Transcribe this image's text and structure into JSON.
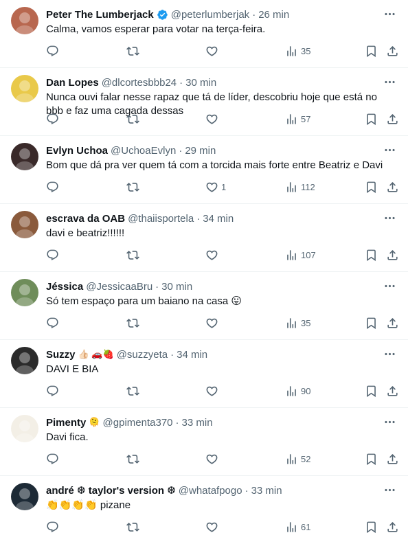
{
  "tweets": [
    {
      "name": "Peter The Lumberjack",
      "handle": "@peterlumberjak",
      "time": "26 min",
      "text": "Calma, vamos esperar para votar na terça-feira.",
      "verified": true,
      "name_emoji": "",
      "likes": "",
      "views": "35",
      "avatar_color": "#b8674f"
    },
    {
      "name": "Dan Lopes",
      "handle": "@dlcortesbbb24",
      "time": "30 min",
      "text": "Nunca ouvi falar nesse rapaz que tá de líder, descobriu hoje que está no bbb e faz uma cagada dessas",
      "verified": false,
      "name_emoji": "",
      "likes": "",
      "views": "57",
      "avatar_color": "#e9c94a"
    },
    {
      "name": "Evlyn Uchoa",
      "handle": "@UchoaEvlyn",
      "time": "29 min",
      "text": "Bom que dá pra ver quem tá com a torcida mais forte entre Beatriz e Davi",
      "verified": false,
      "name_emoji": "",
      "likes": "1",
      "views": "112",
      "avatar_color": "#3a2a2a"
    },
    {
      "name": "escrava da OAB",
      "handle": "@thaiisportela",
      "time": "34 min",
      "text": "davi e beatriz!!!!!!",
      "verified": false,
      "name_emoji": "",
      "likes": "",
      "views": "107",
      "avatar_color": "#8a5a3c"
    },
    {
      "name": "Jéssica",
      "handle": "@JessicaaBru",
      "time": "30 min",
      "text": "Só tem espaço para um baiano na casa 😛",
      "verified": false,
      "name_emoji": "",
      "likes": "",
      "views": "35",
      "avatar_color": "#6f8d5a"
    },
    {
      "name": "Suzzy",
      "handle": "@suzzyeta",
      "time": "34 min",
      "text": "DAVI E BIA",
      "verified": false,
      "name_emoji": "👍🏻 🚗🍓",
      "likes": "",
      "views": "90",
      "avatar_color": "#2b2b2b"
    },
    {
      "name": "Pimenty",
      "handle": "@gpimenta370",
      "time": "33 min",
      "text": "Davi fica.",
      "verified": false,
      "name_emoji": "🫠",
      "likes": "",
      "views": "52",
      "avatar_color": "#f3efe6"
    },
    {
      "name": "andré ❆ taylor's version ❆",
      "handle": "@whatafpogo",
      "time": "33 min",
      "text": "👏👏👏👏 pizane",
      "verified": false,
      "name_emoji": "",
      "likes": "",
      "views": "61",
      "avatar_color": "#1d2a36"
    }
  ],
  "ui": {
    "dot": "·",
    "accent": "#1d9bf0",
    "icon_color": "#536471",
    "icons": [
      "reply-icon",
      "retweet-icon",
      "like-icon",
      "views-icon",
      "bookmark-icon",
      "share-icon",
      "more-icon",
      "verified-icon"
    ]
  }
}
